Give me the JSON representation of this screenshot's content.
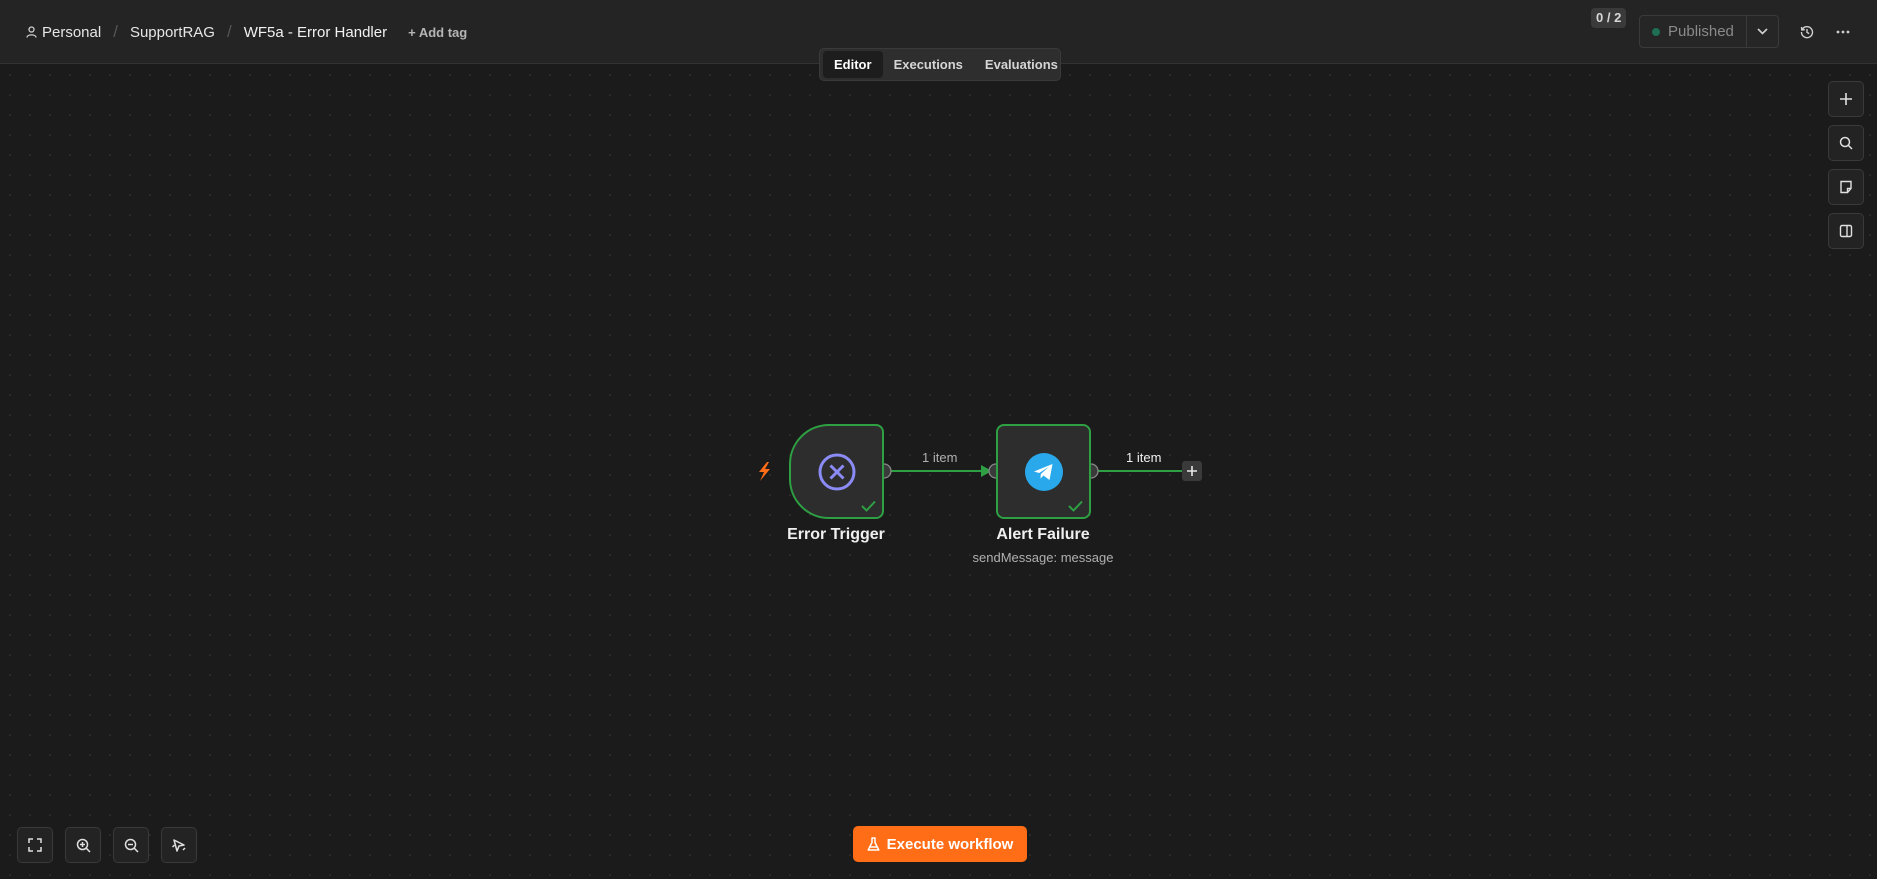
{
  "breadcrumb": {
    "project": "Personal",
    "folder": "SupportRAG",
    "workflow_title": "WF5a - Error Handler",
    "add_tag": "+ Add tag"
  },
  "header": {
    "count_badge": "0 / 2",
    "publish_label": "Published"
  },
  "tabs": [
    "Editor",
    "Executions",
    "Evaluations"
  ],
  "active_tab": "Editor",
  "nodes": [
    {
      "name": "Error Trigger",
      "subtitle": "",
      "icon": "error-x-icon",
      "status": "success"
    },
    {
      "name": "Alert Failure",
      "subtitle": "sendMessage: message",
      "icon": "telegram-icon",
      "status": "success"
    }
  ],
  "edges": [
    {
      "label": "1 item"
    },
    {
      "label": "1 item"
    }
  ],
  "canvas_controls": [
    "fit-view-icon",
    "zoom-in-icon",
    "zoom-out-icon",
    "tidy-up-icon"
  ],
  "side_tools": [
    "add-node-icon",
    "search-icon",
    "sticky-note-icon",
    "panel-toggle-icon"
  ],
  "execute_button": "Execute workflow",
  "colors": {
    "success": "#2ea043",
    "accent": "#ff6d16",
    "telegram": "#29a9eb",
    "error_trigger": "#8b8bf5"
  }
}
